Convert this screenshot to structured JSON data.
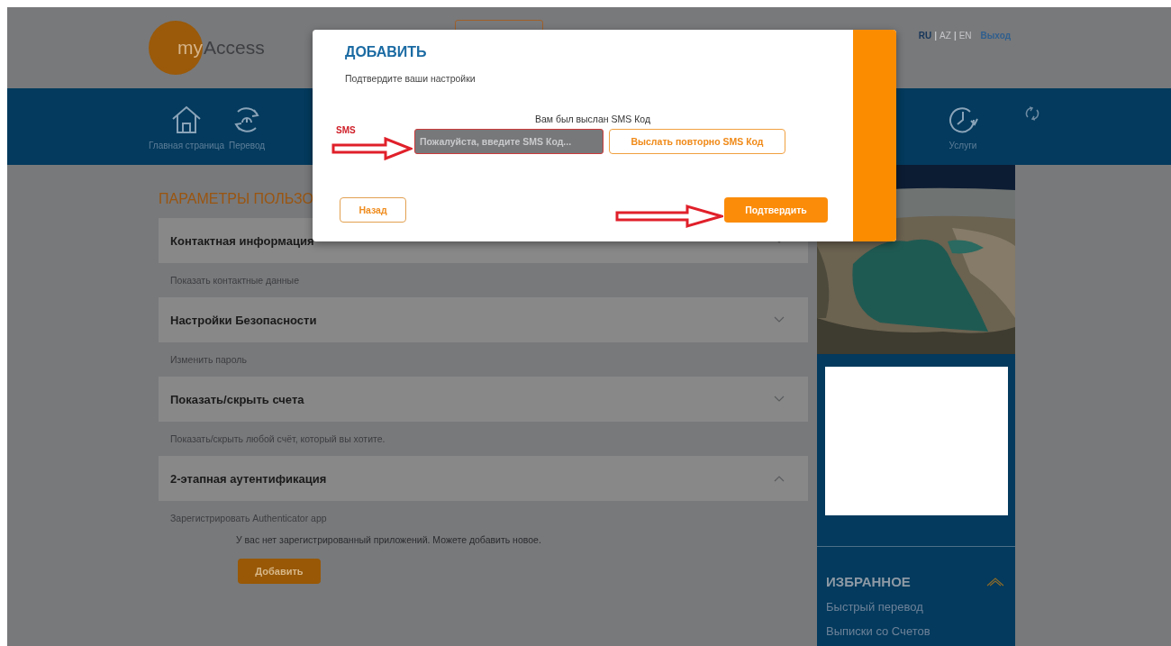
{
  "header": {
    "logo": {
      "part_1": "my",
      "part_2": "Access"
    },
    "languages": [
      {
        "label": "RU",
        "selected": true
      },
      {
        "label": "AZ",
        "selected": false
      },
      {
        "label": "EN",
        "selected": false
      }
    ],
    "separator": "|",
    "logout": "Выход"
  },
  "nav": [
    {
      "label": "Главная страница",
      "kind": "home"
    },
    {
      "label": "Перевод",
      "kind": "transfer"
    },
    {
      "label": "Услуги",
      "kind": "services"
    }
  ],
  "settings": {
    "title": "ПАРАМЕТРЫ ПОЛЬЗО",
    "sections": [
      {
        "title": "Контактная информация",
        "expanded": false,
        "link": "Показать контактные данные"
      },
      {
        "title": "Настройки Безопасности",
        "expanded": false,
        "link": "Изменить пароль"
      },
      {
        "title": "Показать/скрыть счета",
        "expanded": false,
        "link": "Показать/скрыть любой счёт, который вы хотите."
      },
      {
        "title": "2-этапная аутентификация",
        "expanded": true,
        "link": "Зарегистрировать Authenticator app",
        "message": "У вас нет зарегистрированный приложений. Можете добавить новое.",
        "button": "Добавить"
      }
    ]
  },
  "sidebar": {
    "favorites": {
      "title": "ИЗБРАННОЕ",
      "expanded": true,
      "items": [
        "Быстрый перевод",
        "Выписки со Счетов"
      ]
    }
  },
  "modal": {
    "title": "ДОБАВИТЬ",
    "subtitle": "Подтвердите ваши настройки",
    "sms_notice": "Вам был выслан SMS Код",
    "sms_field": {
      "placeholder": "Пожалуйста, введите SMS Код..."
    },
    "resend_button": "Выслать повторно SMS Код",
    "back_button": "Назад",
    "confirm_button": "Подтвердить"
  },
  "annotations": {
    "sms_label": "SMS"
  }
}
